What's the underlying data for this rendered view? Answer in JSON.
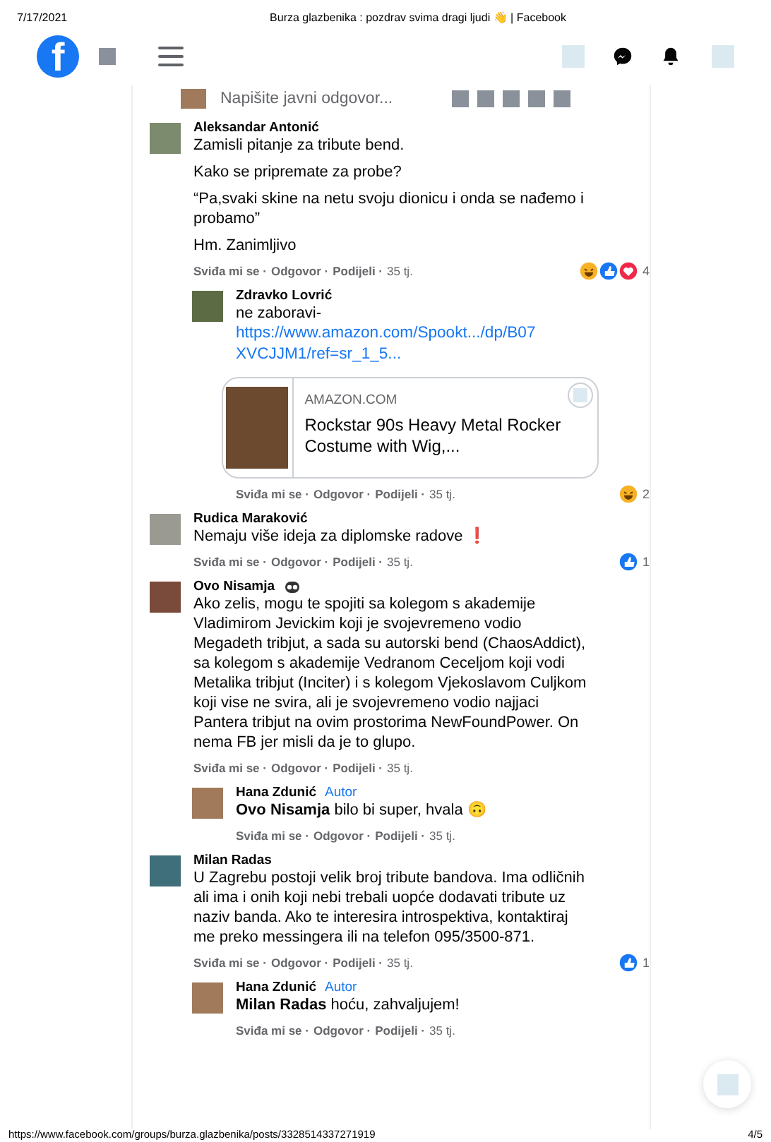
{
  "print_header": {
    "date": "7/17/2021",
    "title": "Burza glazbenika : pozdrav svima dragi ljudi 👋 | Facebook"
  },
  "top_bar": {
    "logo": "f"
  },
  "reply_field": {
    "placeholder": "Napišite javni odgovor..."
  },
  "comments": [
    {
      "author": "Aleksandar Antonić",
      "paragraphs": [
        "Zamisli pitanje za tribute bend.",
        "Kako se pripremate za probe?",
        "“Pa,svaki skine na netu svoju dionicu i onda se nađemo i probamo”",
        "Hm. Zanimljivo"
      ],
      "actions": [
        "Sviđa mi se ·",
        "Odgovor ·",
        "Podijeli ·"
      ],
      "time": "35 tj.",
      "reactions": {
        "icons": [
          {
            "kind": "haha"
          },
          {
            "kind": "like"
          },
          {
            "kind": "love"
          }
        ],
        "count": "4"
      },
      "children": [
        {
          "author": "Zdravko Lovrić",
          "paragraphs": [
            "ne zaboravi-"
          ],
          "link": "https://www.amazon.com/Spookt.../dp/B07XVCJJM1/ref=sr_1_5...",
          "link_preview": {
            "site": "AMAZON.COM",
            "title": "Rockstar 90s Heavy Metal Rocker Costume with Wig,..."
          },
          "actions": [
            "Sviđa mi se ·",
            "Odgovor ·",
            "Podijeli ·"
          ],
          "time": "35 tj.",
          "reactions": {
            "icons": [
              {
                "kind": "haha"
              }
            ],
            "count": "2"
          }
        }
      ]
    },
    {
      "author": "Rudica Maraković",
      "paragraphs": [
        "Nemaju više ideja za diplomske radove ❗"
      ],
      "actions": [
        "Sviđa mi se ·",
        "Odgovor ·",
        "Podijeli ·"
      ],
      "time": "35 tj.",
      "reactions": {
        "icons": [
          {
            "kind": "like"
          }
        ],
        "count": "1"
      }
    },
    {
      "author": "Ovo Nisamja",
      "author_icon": true,
      "paragraphs": [
        "Ako zelis, mogu te spojiti sa kolegom s akademije Vladimirom Jevickim koji je svojevremeno vodio Megadeth tribjut, a sada su autorski bend (ChaosAddict), sa kolegom s akademije Vedranom Ceceljom koji vodi Metalika tribjut (Inciter) i s kolegom Vjekoslavom Culjkom koji vise ne svira, ali je svojevremeno vodio najjaci Pantera tribjut na ovim prostorima NewFoundPower. On nema FB jer misli da je to glupo."
      ],
      "actions": [
        "Sviđa mi se ·",
        "Odgovor ·",
        "Podijeli ·"
      ],
      "time": "35 tj.",
      "children": [
        {
          "author": "Hana Zdunić",
          "badge": "Autor",
          "paragraphs": [
            "**Ovo Nisamja** bilo bi super, hvala 🙃"
          ],
          "actions": [
            "Sviđa mi se ·",
            "Odgovor ·",
            "Podijeli ·"
          ],
          "time": "35 tj."
        }
      ]
    },
    {
      "author": "Milan Radas",
      "paragraphs": [
        "U Zagrebu postoji velik broj tribute bandova. Ima odličnih ali ima i onih koji nebi trebali uopće dodavati tribute uz naziv banda. Ako te interesira introspektiva, kontaktiraj me preko messingera ili na telefon 095/3500-871."
      ],
      "actions": [
        "Sviđa mi se ·",
        "Odgovor ·",
        "Podijeli ·"
      ],
      "time": "35 tj.",
      "reactions": {
        "icons": [
          {
            "kind": "like"
          }
        ],
        "count": "1"
      },
      "children": [
        {
          "author": "Hana Zdunić",
          "badge": "Autor",
          "paragraphs": [
            "**Milan Radas** hoću, zahvaljujem!"
          ],
          "actions": [
            "Sviđa mi se ·",
            "Odgovor ·",
            "Podijeli ·"
          ],
          "time": "35 tj."
        }
      ]
    }
  ],
  "print_footer": {
    "url": "https://www.facebook.com/groups/burza.glazbenika/posts/3328514337271919",
    "page": "4/5"
  }
}
